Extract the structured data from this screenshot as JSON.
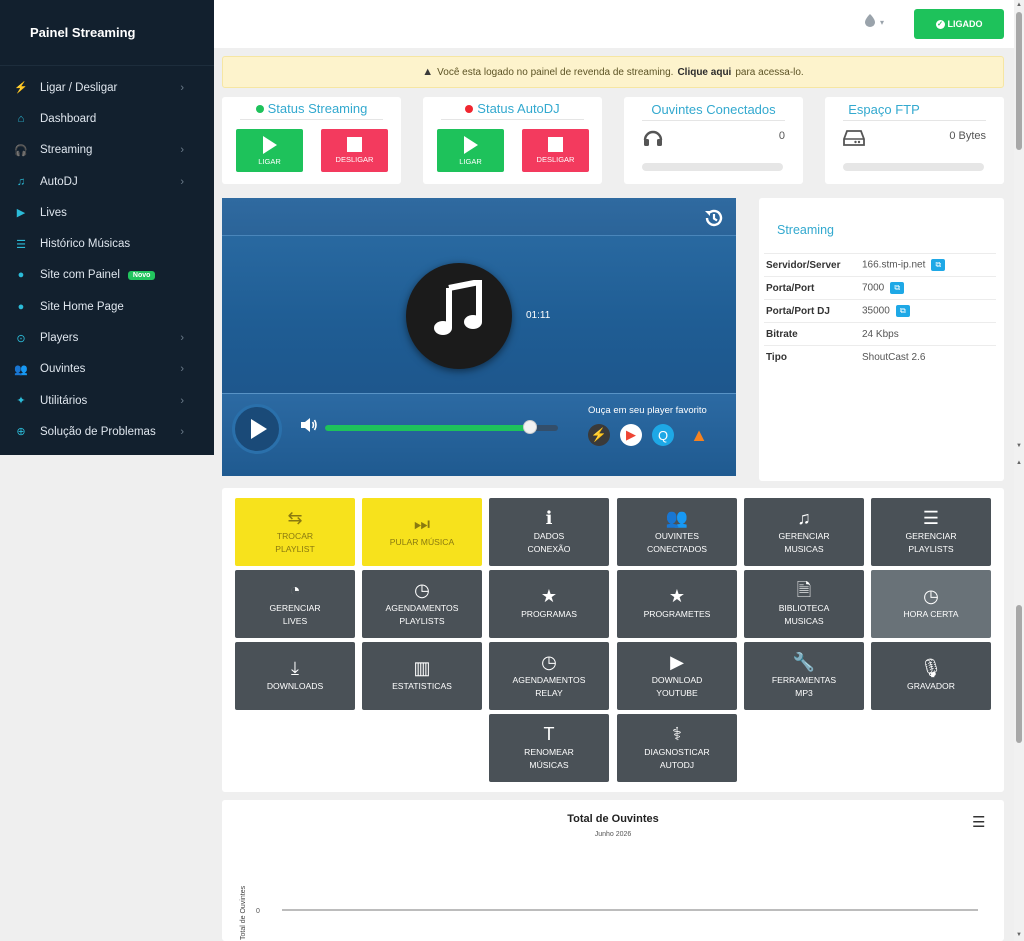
{
  "sidebar": {
    "brand": "Painel Streaming",
    "items": [
      {
        "label": "Ligar / Desligar",
        "icon": "plug-icon",
        "chevron": true
      },
      {
        "label": "Dashboard",
        "icon": "home-icon",
        "chevron": false
      },
      {
        "label": "Streaming",
        "icon": "headphones-icon",
        "chevron": true
      },
      {
        "label": "AutoDJ",
        "icon": "music-icon",
        "chevron": true
      },
      {
        "label": "Lives",
        "icon": "youtube-icon",
        "chevron": false
      },
      {
        "label": "Histórico Músicas",
        "icon": "list-icon",
        "chevron": false
      },
      {
        "label": "Site com Painel",
        "icon": "globe-icon",
        "chevron": false,
        "badge": "Novo"
      },
      {
        "label": "Site Home Page",
        "icon": "globe-icon",
        "chevron": false
      },
      {
        "label": "Players",
        "icon": "play-circle-icon",
        "chevron": true
      },
      {
        "label": "Ouvintes",
        "icon": "users-icon",
        "chevron": true
      },
      {
        "label": "Utilitários",
        "icon": "wrench-icon",
        "chevron": true
      },
      {
        "label": "Solução de Problemas",
        "icon": "lifebuoy-icon",
        "chevron": true
      }
    ]
  },
  "topbar": {
    "user_icon": "user-icon",
    "caret": "▾",
    "status_button": "LIGADO"
  },
  "alert": {
    "text": "Você esta logado no painel de revenda de streaming.",
    "link": "Clique aqui",
    "suffix": "para acessa-lo."
  },
  "status_cards": {
    "streaming": {
      "title": "Status Streaming",
      "dot_color": "#1ec25b",
      "on": "LIGAR",
      "off": "DESLIGAR"
    },
    "autodj": {
      "title": "Status AutoDJ",
      "dot_color": "#f0262f",
      "on": "LIGAR",
      "off": "DESLIGAR"
    },
    "ouvintes": {
      "title": "Ouvintes Conectados",
      "value": "0",
      "progress": 0
    },
    "ftp": {
      "title": "Espaço FTP",
      "value": "0 Bytes",
      "progress": 0
    }
  },
  "player": {
    "time": "01:11",
    "favorite_label": "Ouça em seu player favorito",
    "volume": 0.88
  },
  "streaming_info": {
    "title": "Streaming",
    "rows": [
      {
        "key": "Servidor/Server",
        "value": "166.stm-ip.net",
        "copy": true
      },
      {
        "key": "Porta/Port",
        "value": "7000",
        "copy": true
      },
      {
        "key": "Porta/Port DJ",
        "value": "35000",
        "copy": true
      },
      {
        "key": "Bitrate",
        "value": "24 Kbps",
        "copy": false
      },
      {
        "key": "Tipo",
        "value": "ShoutCast 2.6",
        "copy": false
      }
    ]
  },
  "tiles": [
    {
      "l1": "TROCAR",
      "l2": "PLAYLIST",
      "icon": "retweet-icon",
      "glyph": "⇆",
      "style": "yellow"
    },
    {
      "l1": "PULAR MÚSICA",
      "l2": "",
      "icon": "skip-icon",
      "glyph": "⏭",
      "style": "yellow"
    },
    {
      "l1": "DADOS",
      "l2": "CONEXÃO",
      "icon": "info-icon",
      "glyph": "ℹ",
      "style": "dark"
    },
    {
      "l1": "OUVINTES",
      "l2": "CONECTADOS",
      "icon": "users-icon",
      "glyph": "👥",
      "style": "dark"
    },
    {
      "l1": "GERENCIAR",
      "l2": "MUSICAS",
      "icon": "music-icon",
      "glyph": "♫",
      "style": "dark"
    },
    {
      "l1": "GERENCIAR",
      "l2": "PLAYLISTS",
      "icon": "list-icon",
      "glyph": "☰",
      "style": "dark"
    },
    {
      "l1": "GERENCIAR",
      "l2": "LIVES",
      "icon": "rss-icon",
      "glyph": "◔",
      "style": "dark"
    },
    {
      "l1": "AGENDAMENTOS",
      "l2": "PLAYLISTS",
      "icon": "clock-icon",
      "glyph": "◷",
      "style": "dark"
    },
    {
      "l1": "PROGRAMAS",
      "l2": "",
      "icon": "star-icon",
      "glyph": "★",
      "style": "dark"
    },
    {
      "l1": "PROGRAMETES",
      "l2": "",
      "icon": "star-icon",
      "glyph": "★",
      "style": "dark"
    },
    {
      "l1": "BIBLIOTECA",
      "l2": "MUSICAS",
      "icon": "audio-file-icon",
      "glyph": "🗎",
      "style": "dark"
    },
    {
      "l1": "HORA CERTA",
      "l2": "",
      "icon": "clock-icon",
      "glyph": "◷",
      "style": "light"
    },
    {
      "l1": "DOWNLOADS",
      "l2": "",
      "icon": "download-icon",
      "glyph": "⤓",
      "style": "dark"
    },
    {
      "l1": "ESTATISTICAS",
      "l2": "",
      "icon": "bar-chart-icon",
      "glyph": "▥",
      "style": "dark"
    },
    {
      "l1": "AGENDAMENTOS",
      "l2": "RELAY",
      "icon": "clock-icon",
      "glyph": "◷",
      "style": "dark"
    },
    {
      "l1": "DOWNLOAD",
      "l2": "YOUTUBE",
      "icon": "youtube-icon",
      "glyph": "▶",
      "style": "dark"
    },
    {
      "l1": "FERRAMENTAS",
      "l2": "MP3",
      "icon": "wrench-icon",
      "glyph": "🔧",
      "style": "dark"
    },
    {
      "l1": "GRAVADOR",
      "l2": "",
      "icon": "microphone-icon",
      "glyph": "🎙",
      "style": "dark"
    },
    {
      "l1": "RENOMEAR",
      "l2": "MÚSICAS",
      "icon": "text-icon",
      "glyph": "T",
      "style": "dark"
    },
    {
      "l1": "DIAGNOSTICAR",
      "l2": "AUTODJ",
      "icon": "stethoscope-icon",
      "glyph": "⚕",
      "style": "dark"
    }
  ],
  "chart_data": {
    "type": "line",
    "title": "Total de Ouvintes",
    "subtitle": "Junho 2026",
    "xlabel": "",
    "ylabel": "Total de Ouvintes",
    "y_ticks": [
      "0"
    ],
    "series": [
      {
        "values": [
          0
        ]
      }
    ]
  }
}
